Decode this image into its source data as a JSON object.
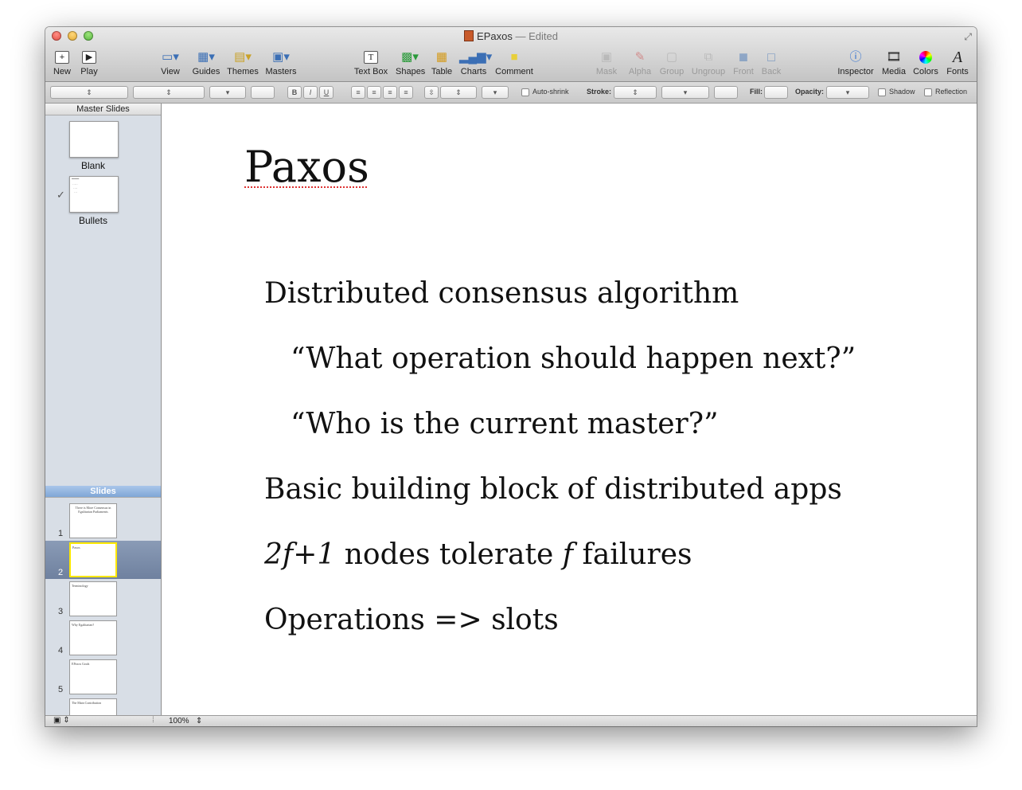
{
  "window": {
    "title": "EPaxos",
    "title_suffix": " — Edited"
  },
  "toolbar": {
    "new": "New",
    "play": "Play",
    "view": "View",
    "guides": "Guides",
    "themes": "Themes",
    "masters": "Masters",
    "text_box": "Text Box",
    "shapes": "Shapes",
    "table": "Table",
    "charts": "Charts",
    "comment": "Comment",
    "mask": "Mask",
    "alpha": "Alpha",
    "group": "Group",
    "ungroup": "Ungroup",
    "front": "Front",
    "back": "Back",
    "inspector": "Inspector",
    "media": "Media",
    "colors": "Colors",
    "fonts": "Fonts"
  },
  "formatbar": {
    "bold": "B",
    "italic": "I",
    "underline": "U",
    "auto_shrink": "Auto-shrink",
    "stroke": "Stroke:",
    "fill": "Fill:",
    "opacity": "Opacity:",
    "shadow": "Shadow",
    "reflection": "Reflection"
  },
  "sidebar": {
    "master_header": "Master Slides",
    "masters": [
      {
        "label": "Blank"
      },
      {
        "label": "Bullets",
        "checked": true
      }
    ],
    "slides_header": "Slides",
    "slides": [
      {
        "num": "1",
        "thumb": "There is More Consensus in Egalitarian Parliaments"
      },
      {
        "num": "2",
        "thumb": "Paxos"
      },
      {
        "num": "3",
        "thumb": "Terminology"
      },
      {
        "num": "4",
        "thumb": "Why Egalitarian?"
      },
      {
        "num": "5",
        "thumb": "EPaxos Goals"
      },
      {
        "num": "",
        "thumb": "The Main Contribution"
      }
    ]
  },
  "slide": {
    "title": "Paxos",
    "bullets": {
      "b1": "Distributed consensus algorithm",
      "b2": "“What operation should happen next?”",
      "b3": "“Who is the current master?”",
      "b4": "Basic building block of distributed apps",
      "b5_italic_a": "2f+1",
      "b5_mid": " nodes tolerate ",
      "b5_italic_b": "f",
      "b5_end": " failures",
      "b6": "Operations => slots"
    }
  },
  "status": {
    "zoom": "100%"
  }
}
